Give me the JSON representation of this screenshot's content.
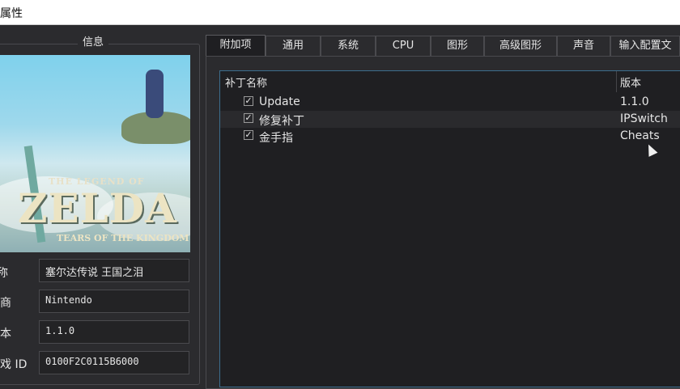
{
  "window": {
    "title": "属性"
  },
  "info": {
    "caption": "信息",
    "cover": {
      "line1": "THE LEGEND OF",
      "line2": "ZELDA",
      "line3": "TEARS OF THE KINGDOM"
    },
    "fields": [
      {
        "label": "名称",
        "value": "塞尔达传说 王国之泪"
      },
      {
        "label": "开发商",
        "value": "Nintendo"
      },
      {
        "label": "版本",
        "value": "1.1.0"
      },
      {
        "label": "游戏 ID",
        "value": "0100F2C0115B6000"
      }
    ]
  },
  "tabs": [
    {
      "label": "附加项",
      "active": true
    },
    {
      "label": "通用"
    },
    {
      "label": "系统"
    },
    {
      "label": "CPU"
    },
    {
      "label": "图形"
    },
    {
      "label": "高级图形"
    },
    {
      "label": "声音"
    },
    {
      "label": "输入配置文"
    }
  ],
  "addons": {
    "columns": [
      "补丁名称",
      "版本"
    ],
    "rows": [
      {
        "name": "Update",
        "version": "1.1.0",
        "checked": true
      },
      {
        "name": "修复补丁",
        "version": "IPSwitch",
        "checked": true
      },
      {
        "name": "金手指",
        "version": "Cheats",
        "checked": true
      }
    ],
    "check_glyph": "✓"
  }
}
